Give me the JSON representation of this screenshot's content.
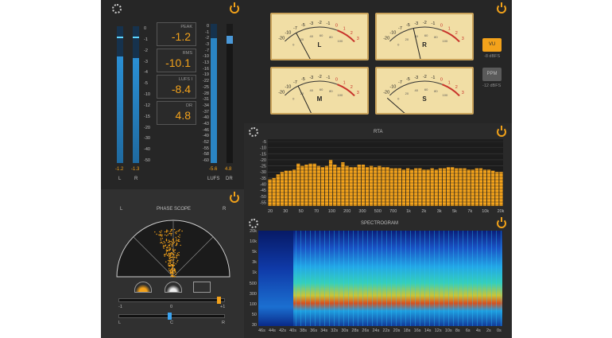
{
  "colors": {
    "accent": "#f3a21b",
    "meter_blue": "#2c8fd0",
    "panel": "#2e2e2e"
  },
  "level_meter": {
    "scale": [
      "0",
      "-1",
      "-2",
      "-3",
      "-4",
      "-5",
      "-10",
      "-12",
      "-15",
      "-20",
      "-30",
      "-40",
      "-50"
    ],
    "peak_label": "PEAK",
    "peak_value": "-1.2",
    "rms_label": "RMS",
    "rms_value": "-10.1",
    "lufs_label": "LUFS I",
    "lufs_value": "-8.4",
    "dr_label": "DR",
    "dr_value": "4.8",
    "ch_l_readout": "-1.2",
    "ch_r_readout": "-1.3",
    "ch_l_label": "L",
    "ch_r_label": "R",
    "lufs_scale": [
      "0",
      "-1",
      "-2",
      "-3",
      "-7",
      "-10",
      "-13",
      "-16",
      "-19",
      "-22",
      "-25",
      "-28",
      "-31",
      "-34",
      "-37",
      "-40",
      "-43",
      "-46",
      "-49",
      "-52",
      "-55",
      "-58",
      "-60"
    ],
    "lufs_readout": "-5.6",
    "dr_readout": "4.8",
    "lufs_col_label": "LUFS",
    "dr_col_label": "DR",
    "l_level": 0.78,
    "r_level": 0.77,
    "lufs_level": 0.9,
    "dr_level": 0.92
  },
  "phase_scope": {
    "title": "PHASE SCOPE",
    "left_label": "L",
    "right_label": "R",
    "correlation_scale": [
      "-1",
      "0",
      "+1"
    ],
    "correlation": 0.88,
    "balance_scale": [
      "L",
      "C",
      "R"
    ],
    "balance": -0.05
  },
  "vu_meters": {
    "scale_top": [
      "-20",
      "-10",
      "-7",
      "-5",
      "-3",
      "-2",
      "-1",
      "0",
      "1",
      "2",
      "3"
    ],
    "scale_bottom": [
      "0",
      "20",
      "40",
      "60",
      "80",
      "100"
    ],
    "channels": [
      {
        "label": "L",
        "needle": -0.55
      },
      {
        "label": "R",
        "needle": -0.25
      },
      {
        "label": "M",
        "needle": -0.5
      },
      {
        "label": "S",
        "needle": -0.95
      }
    ],
    "vu_button": "VU",
    "vu_sub": "-8 dBFS",
    "ppm_button": "PPM",
    "ppm_sub": "-12 dBFS"
  },
  "rta": {
    "title": "RTA",
    "y_ticks": [
      "-5",
      "-10",
      "-15",
      "-20",
      "-25",
      "-30",
      "-35",
      "-40",
      "-45",
      "-50",
      "-55"
    ],
    "x_ticks": [
      "20",
      "30",
      "50",
      "70",
      "100",
      "200",
      "300",
      "500",
      "700",
      "1k",
      "2k",
      "3k",
      "5k",
      "7k",
      "10k",
      "20k"
    ]
  },
  "chart_data": {
    "type": "bar",
    "title": "RTA",
    "xlabel": "",
    "ylabel": "",
    "ylim": [
      -58,
      -3
    ],
    "values": [
      -36,
      -35,
      -32,
      -30,
      -29,
      -29,
      -28,
      -23,
      -25,
      -24,
      -23,
      -23,
      -25,
      -26,
      -25,
      -20,
      -24,
      -26,
      -22,
      -25,
      -26,
      -26,
      -24,
      -24,
      -26,
      -25,
      -26,
      -25,
      -26,
      -26,
      -27,
      -27,
      -27,
      -28,
      -27,
      -28,
      -27,
      -27,
      -28,
      -28,
      -27,
      -28,
      -27,
      -27,
      -26,
      -26,
      -27,
      -27,
      -27,
      -28,
      -28,
      -27,
      -27,
      -28,
      -28,
      -29,
      -30,
      -30
    ]
  },
  "spectrogram": {
    "title": "SPECTROGRAM",
    "y_ticks": [
      "20k",
      "10k",
      "5k",
      "3k",
      "1k",
      "500",
      "300",
      "100",
      "50",
      "30"
    ],
    "x_ticks": [
      "46s",
      "44s",
      "42s",
      "40s",
      "38s",
      "36s",
      "34s",
      "32s",
      "30s",
      "28s",
      "26s",
      "24s",
      "22s",
      "20s",
      "18s",
      "16s",
      "14s",
      "12s",
      "10s",
      "8s",
      "6s",
      "4s",
      "2s",
      "0s"
    ]
  }
}
